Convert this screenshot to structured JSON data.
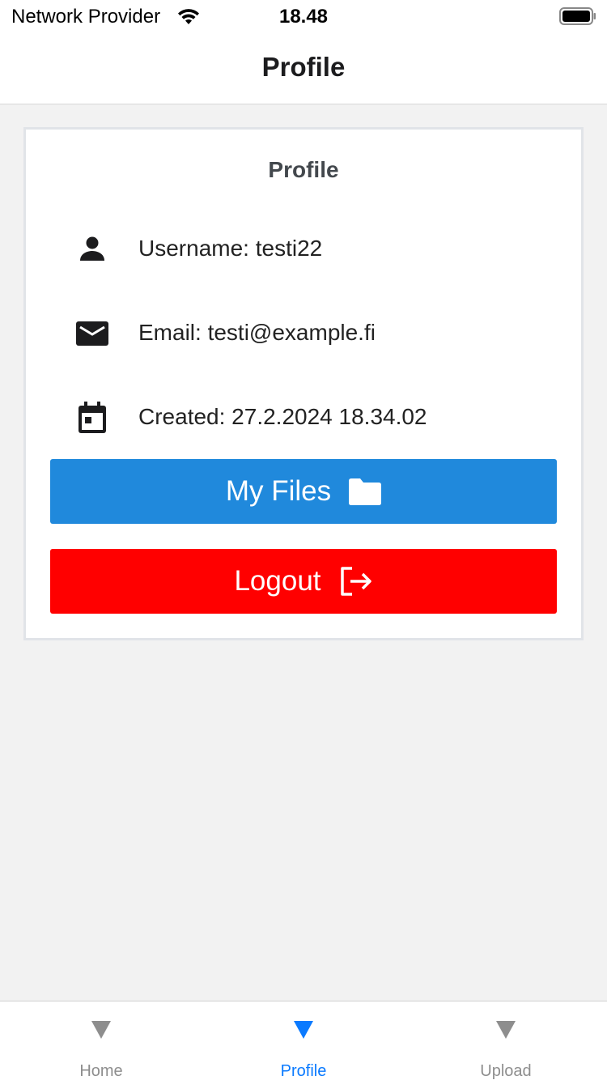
{
  "status_bar": {
    "carrier": "Network Provider",
    "time": "18.48"
  },
  "nav": {
    "title": "Profile"
  },
  "card": {
    "title": "Profile",
    "username": "Username: testi22",
    "email": "Email: testi@example.fi",
    "created": "Created: 27.2.2024 18.34.02"
  },
  "buttons": {
    "my_files": "My Files",
    "logout": "Logout"
  },
  "tabs": [
    {
      "label": "Home",
      "icon": "triangle-down-icon",
      "active": false
    },
    {
      "label": "Profile",
      "icon": "triangle-down-icon",
      "active": true
    },
    {
      "label": "Upload",
      "icon": "triangle-down-icon",
      "active": false
    }
  ],
  "colors": {
    "primary_button": "#2089dc",
    "logout_button": "#ff0000",
    "active_tab": "#0a7aff",
    "inactive_tab": "#8e8e8e",
    "background": "#f2f2f2"
  }
}
